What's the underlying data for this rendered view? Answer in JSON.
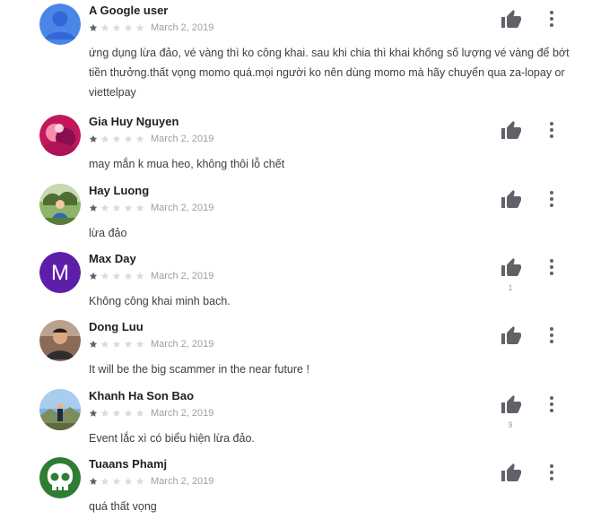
{
  "review_date": "March 2, 2019",
  "colors": {
    "star_filled": "#5f6368",
    "star_empty": "#dadce0",
    "icon": "#5f6368"
  },
  "reviews": [
    {
      "author": "A Google user",
      "rating": 1,
      "date": "March 2, 2019",
      "text": "ứng dụng lừa đảo, vé vàng thì ko công khai. sau khi chia thì khai khống số lượng vé vàng để bớt tiền thưởng.thất vọng momo quá.mọi người ko nên dùng momo mà hãy chuyển qua za-lopay or viettelpay",
      "helpful_count": "",
      "avatar": {
        "type": "default-user-icon",
        "color": "#4a86e8"
      }
    },
    {
      "author": "Gia Huy Nguyen",
      "rating": 1,
      "date": "March 2, 2019",
      "text": "may mắn k mua heo, không thôi lỗ chết",
      "helpful_count": "",
      "avatar": {
        "type": "photo",
        "color": "#c2185b"
      }
    },
    {
      "author": "Hay Luong",
      "rating": 1,
      "date": "March 2, 2019",
      "text": "lừa đảo",
      "helpful_count": "",
      "avatar": {
        "type": "photo",
        "color": "#6d8c4a"
      }
    },
    {
      "author": "Max Day",
      "rating": 1,
      "date": "March 2, 2019",
      "text": "Không công khai minh bach.",
      "helpful_count": "1",
      "avatar": {
        "type": "letter",
        "letter": "M",
        "color": "#5e1fa8"
      }
    },
    {
      "author": "Dong Luu",
      "rating": 1,
      "date": "March 2, 2019",
      "text": "It will be the big scammer in the near future !",
      "helpful_count": "",
      "avatar": {
        "type": "photo",
        "color": "#6b4b3a"
      }
    },
    {
      "author": "Khanh Ha Son Bao",
      "rating": 1,
      "date": "March 2, 2019",
      "text": "Event lắc xì có biểu hiện lừa đảo.",
      "helpful_count": "9",
      "avatar": {
        "type": "photo",
        "color": "#5d8fc4"
      }
    },
    {
      "author": "Tuaans Phamj",
      "rating": 1,
      "date": "March 2, 2019",
      "text": "quá thất vọng",
      "helpful_count": "",
      "avatar": {
        "type": "skull-icon",
        "color": "#2e7d32"
      }
    }
  ]
}
